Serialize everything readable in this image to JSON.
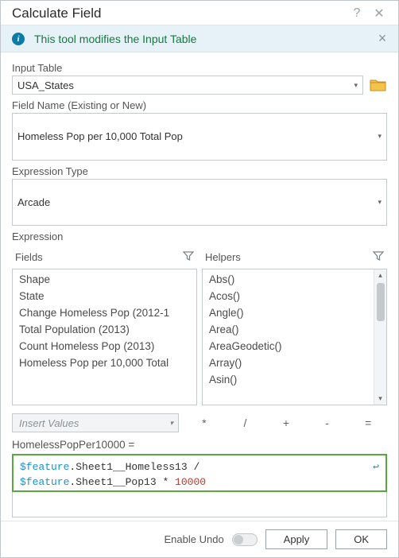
{
  "window": {
    "title": "Calculate Field"
  },
  "info": {
    "text": "This tool modifies the Input Table"
  },
  "inputTable": {
    "label": "Input Table",
    "value": "USA_States"
  },
  "fieldName": {
    "label": "Field Name (Existing or New)",
    "value": "Homeless Pop per 10,000 Total Pop"
  },
  "exprType": {
    "label": "Expression Type",
    "value": "Arcade"
  },
  "expression": {
    "label": "Expression",
    "fieldsHeader": "Fields",
    "helpersHeader": "Helpers",
    "fields": [
      "Shape",
      "State",
      "Change Homeless Pop (2012-1",
      "Total Population (2013)",
      "Count Homeless Pop (2013)",
      "Homeless Pop per 10,000 Total"
    ],
    "helpers": [
      "Abs()",
      "Acos()",
      "Angle()",
      "Area()",
      "AreaGeodetic()",
      "Array()",
      "Asin()"
    ],
    "insertValuesPlaceholder": "Insert Values",
    "ops": [
      "*",
      "/",
      "+",
      "-",
      "="
    ],
    "assignLabel": "HomelessPopPer10000 =",
    "code": {
      "line1_kw": "$feature",
      "line1_rest": ".Sheet1__Homeless13 /",
      "line2_kw": "$feature",
      "line2_mid": ".Sheet1__Pop13 * ",
      "line2_num": "10000"
    }
  },
  "footer": {
    "undoLabel": "Enable Undo",
    "apply": "Apply",
    "ok": "OK"
  }
}
